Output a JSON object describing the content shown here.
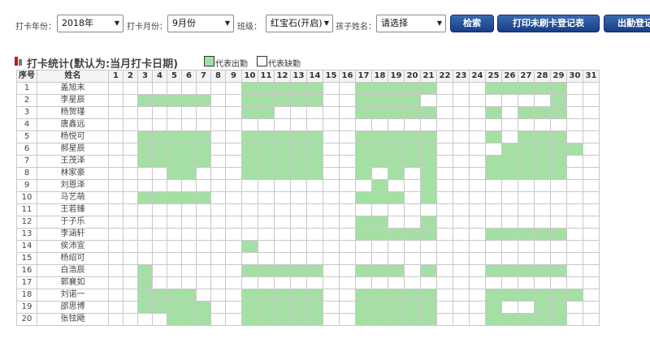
{
  "filters": {
    "year_label": "打卡年份：",
    "year_value": "2018年",
    "month_label": "打卡月份：",
    "month_value": "9月份",
    "class_label": "班级：",
    "class_value": "红宝石(开启)",
    "child_label": "孩子姓名：",
    "child_value": "请选择",
    "search_button": "检索",
    "print_button": "打印未刷卡登记表",
    "export_button": "出勤登记"
  },
  "section": {
    "title": "打卡统计(默认为:当月打卡日期)",
    "legend_present": "代表出勤",
    "legend_absent": "代表缺勤"
  },
  "colors": {
    "present": "#a4e0a4",
    "absent": "#ffffff",
    "button": "#1f4a92",
    "title_bar": "#b02020"
  },
  "table": {
    "col_index": "序号",
    "col_name": "姓名",
    "days": [
      "1",
      "2",
      "3",
      "4",
      "5",
      "6",
      "7",
      "8",
      "9",
      "10",
      "11",
      "12",
      "13",
      "14",
      "15",
      "16",
      "17",
      "18",
      "19",
      "20",
      "21",
      "22",
      "23",
      "24",
      "25",
      "26",
      "27",
      "28",
      "29",
      "30",
      "31"
    ],
    "rows": [
      {
        "index": "1",
        "name": "盖旭末",
        "present": [
          10,
          11,
          12,
          13,
          14,
          17,
          18,
          19,
          20,
          21,
          25,
          26,
          27,
          28,
          29
        ]
      },
      {
        "index": "2",
        "name": "李星辰",
        "present": [
          3,
          4,
          5,
          6,
          7,
          10,
          11,
          12,
          13,
          14,
          17,
          18,
          19,
          20,
          29
        ]
      },
      {
        "index": "3",
        "name": "杨贺瑾",
        "present": [
          10,
          11,
          17,
          18,
          19,
          20,
          21,
          25,
          27,
          28,
          29
        ]
      },
      {
        "index": "4",
        "name": "唐鑫远",
        "present": []
      },
      {
        "index": "5",
        "name": "杨悦可",
        "present": [
          3,
          4,
          5,
          6,
          7,
          10,
          11,
          12,
          13,
          14,
          17,
          18,
          19,
          20,
          21,
          25,
          27,
          28,
          29
        ]
      },
      {
        "index": "6",
        "name": "郝星辰",
        "present": [
          3,
          4,
          5,
          6,
          7,
          10,
          11,
          12,
          13,
          14,
          17,
          18,
          19,
          20,
          21,
          26,
          27,
          28,
          29,
          30
        ]
      },
      {
        "index": "7",
        "name": "王茂泽",
        "present": [
          3,
          4,
          5,
          6,
          7,
          10,
          11,
          12,
          13,
          14,
          17,
          18,
          19,
          20,
          21,
          25,
          26,
          27,
          28,
          29
        ]
      },
      {
        "index": "8",
        "name": "林家豪",
        "present": [
          5,
          6,
          10,
          11,
          12,
          13,
          14,
          17,
          19,
          21,
          25,
          26,
          27,
          28,
          29
        ]
      },
      {
        "index": "9",
        "name": "刘恩泽",
        "present": [
          18,
          21
        ]
      },
      {
        "index": "10",
        "name": "马艺萌",
        "present": [
          3,
          4,
          5,
          6,
          7,
          17,
          18,
          19,
          21
        ]
      },
      {
        "index": "11",
        "name": "王若臻",
        "present": []
      },
      {
        "index": "12",
        "name": "于子乐",
        "present": [
          17,
          18,
          21
        ]
      },
      {
        "index": "13",
        "name": "李涵轩",
        "present": [
          17,
          18,
          19,
          20,
          21,
          25,
          26,
          27,
          28,
          29
        ]
      },
      {
        "index": "14",
        "name": "侯沛宣",
        "present": [
          10
        ]
      },
      {
        "index": "15",
        "name": "杨绍可",
        "present": []
      },
      {
        "index": "16",
        "name": "白浩辰",
        "present": [
          3,
          10,
          11,
          12,
          13,
          14,
          17,
          18,
          19,
          21,
          25,
          26,
          27,
          28,
          29
        ]
      },
      {
        "index": "17",
        "name": "郭襄如",
        "present": [
          3
        ]
      },
      {
        "index": "18",
        "name": "刘诺一",
        "present": [
          3,
          4,
          5,
          6,
          10,
          11,
          12,
          13,
          14,
          17,
          18,
          19,
          20,
          21,
          25,
          26,
          27,
          28,
          29,
          30
        ]
      },
      {
        "index": "19",
        "name": "邵思博",
        "present": [
          3,
          4,
          5,
          6,
          7,
          10,
          11,
          12,
          13,
          14,
          17,
          18,
          19,
          20,
          21,
          25,
          28,
          29
        ]
      },
      {
        "index": "20",
        "name": "张铉飏",
        "present": [
          5,
          6,
          7,
          10,
          11,
          12,
          13,
          14,
          17,
          18,
          19,
          20,
          21,
          25,
          26,
          27,
          28,
          29
        ]
      }
    ]
  }
}
